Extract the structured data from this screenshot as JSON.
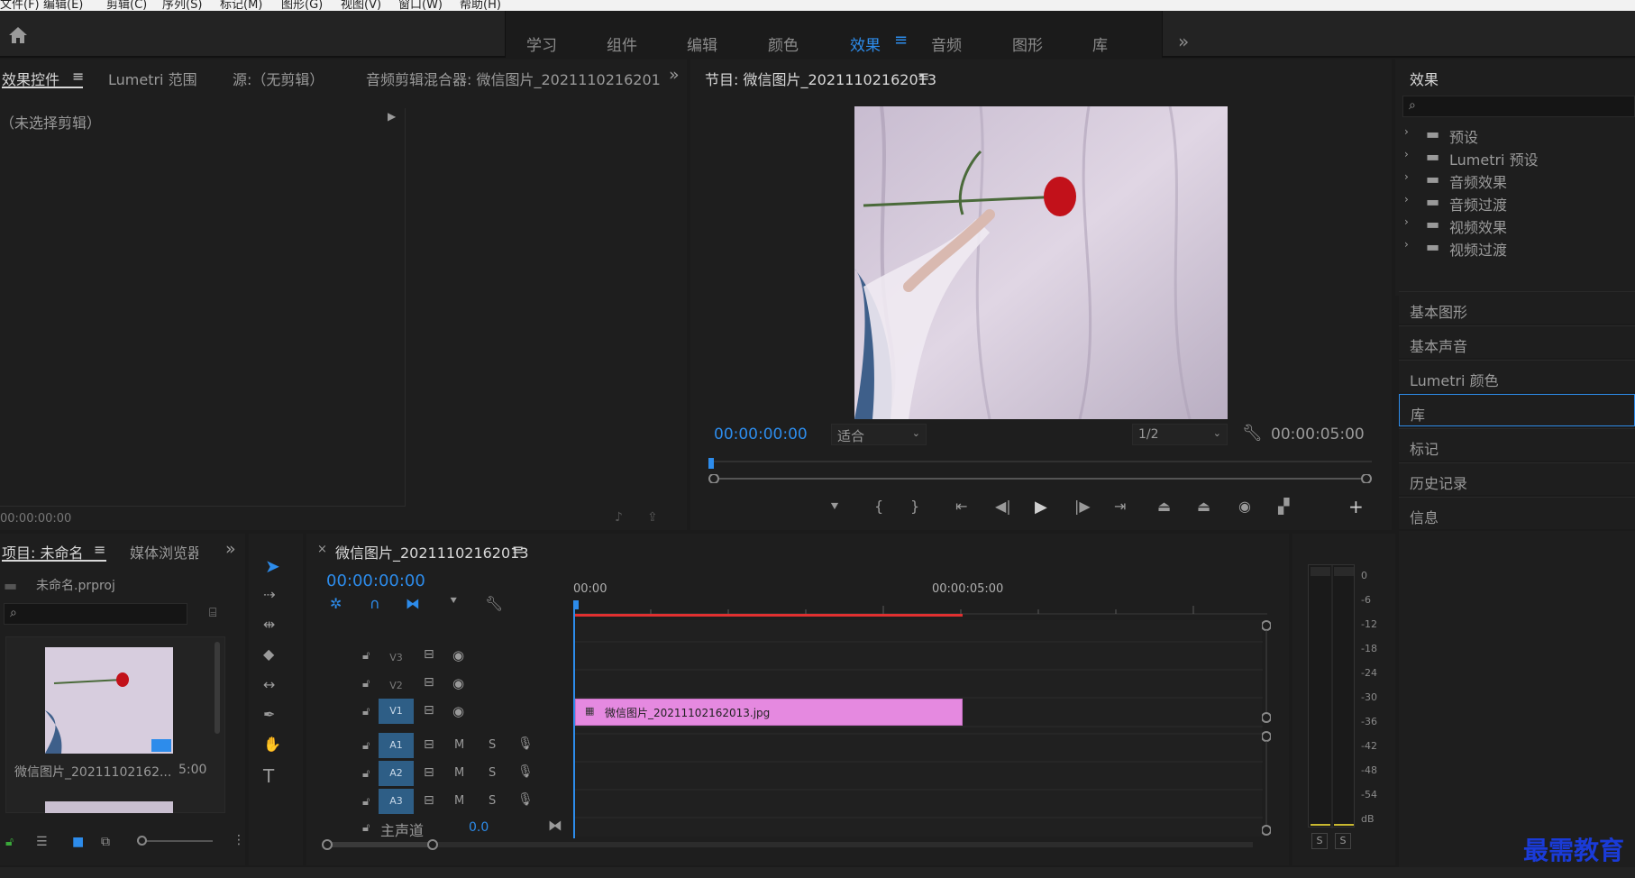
{
  "menu": [
    "文件(F)",
    "编辑(E)",
    "剪辑(C)",
    "序列(S)",
    "标记(M)",
    "图形(G)",
    "视图(V)",
    "窗口(W)",
    "帮助(H)"
  ],
  "workspaces": [
    "学习",
    "组件",
    "编辑",
    "颜色",
    "效果",
    "音频",
    "图形",
    "库"
  ],
  "active_workspace": "效果",
  "source_panel": {
    "tabs": [
      "效果控件",
      "Lumetri 范围",
      "源:（无剪辑）",
      "音频剪辑混合器: 微信图片_2021110216201"
    ],
    "no_clip": "（未选择剪辑）",
    "timecode": "00:00:00:00"
  },
  "program": {
    "title": "节目: 微信图片_20211102162013",
    "timecode_current": "00:00:00:00",
    "fit": "适合",
    "resolution": "1/2",
    "timecode_duration": "00:00:05:00"
  },
  "effects_panel": {
    "title": "效果",
    "items": [
      "预设",
      "Lumetri 预设",
      "音频效果",
      "音频过渡",
      "视频效果",
      "视频过渡"
    ],
    "sections": [
      "基本图形",
      "基本声音",
      "Lumetri 颜色",
      "库",
      "标记",
      "历史记录",
      "信息"
    ],
    "active_section": "库"
  },
  "project": {
    "tabs": [
      "项目: 未命名",
      "媒体浏览器"
    ],
    "file": "未命名.prproj",
    "clip_name": "微信图片_20211102162...",
    "clip_duration": "5:00"
  },
  "timeline": {
    "title": "微信图片_20211102162013",
    "timecode": "00:00:00:00",
    "ruler": [
      "00:00",
      "00:00:05:00"
    ],
    "tracks_video": [
      "V3",
      "V2",
      "V1"
    ],
    "tracks_audio": [
      "A1",
      "A2",
      "A3"
    ],
    "master": "主声道",
    "master_value": "0.0",
    "mute": "M",
    "solo": "S",
    "clip": "微信图片_20211102162013.jpg"
  },
  "meter": {
    "labels": [
      "0",
      "-6",
      "-12",
      "-18",
      "-24",
      "-30",
      "-36",
      "-42",
      "-48",
      "-54",
      "dB"
    ],
    "solo_left": "S",
    "solo_right": "S"
  },
  "watermark": "最需教育",
  "colors": {
    "accent": "#2d8ceb",
    "clip": "#e589e0",
    "playhead_bar": "#e03030"
  }
}
